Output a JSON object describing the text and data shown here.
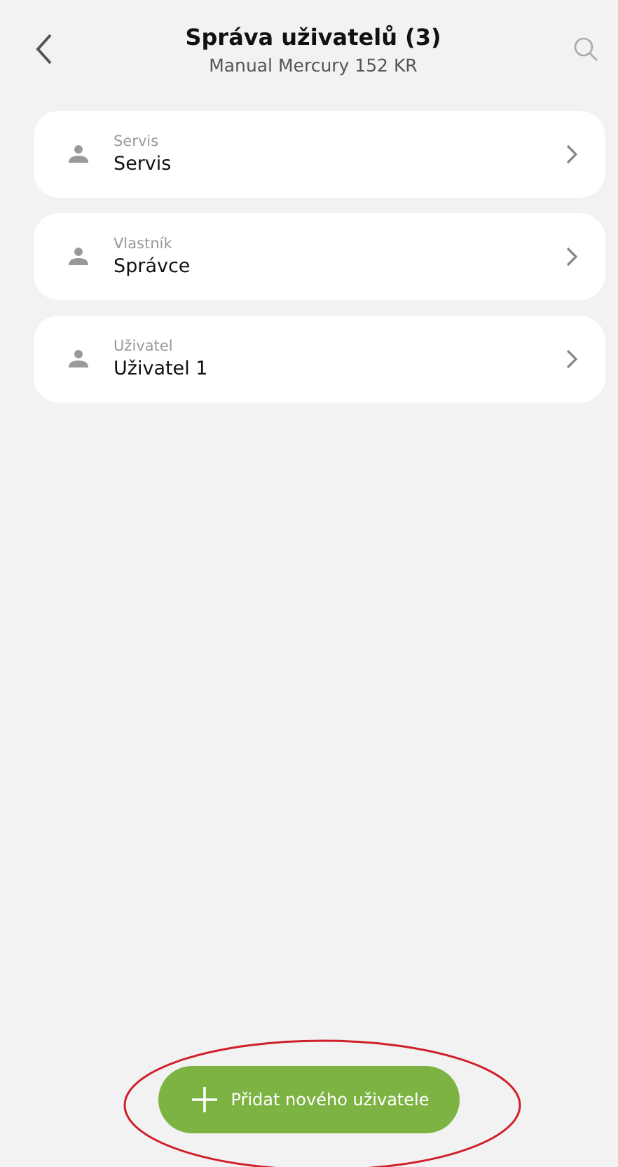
{
  "header": {
    "title": "Správa uživatelů (3)",
    "subtitle": "Manual Mercury 152 KR"
  },
  "users": [
    {
      "role": "Servis",
      "name": "Servis"
    },
    {
      "role": "Vlastník",
      "name": "Správce"
    },
    {
      "role": "Uživatel",
      "name": "Uživatel 1"
    }
  ],
  "add_button": {
    "label": "Přidat nového uživatele"
  }
}
